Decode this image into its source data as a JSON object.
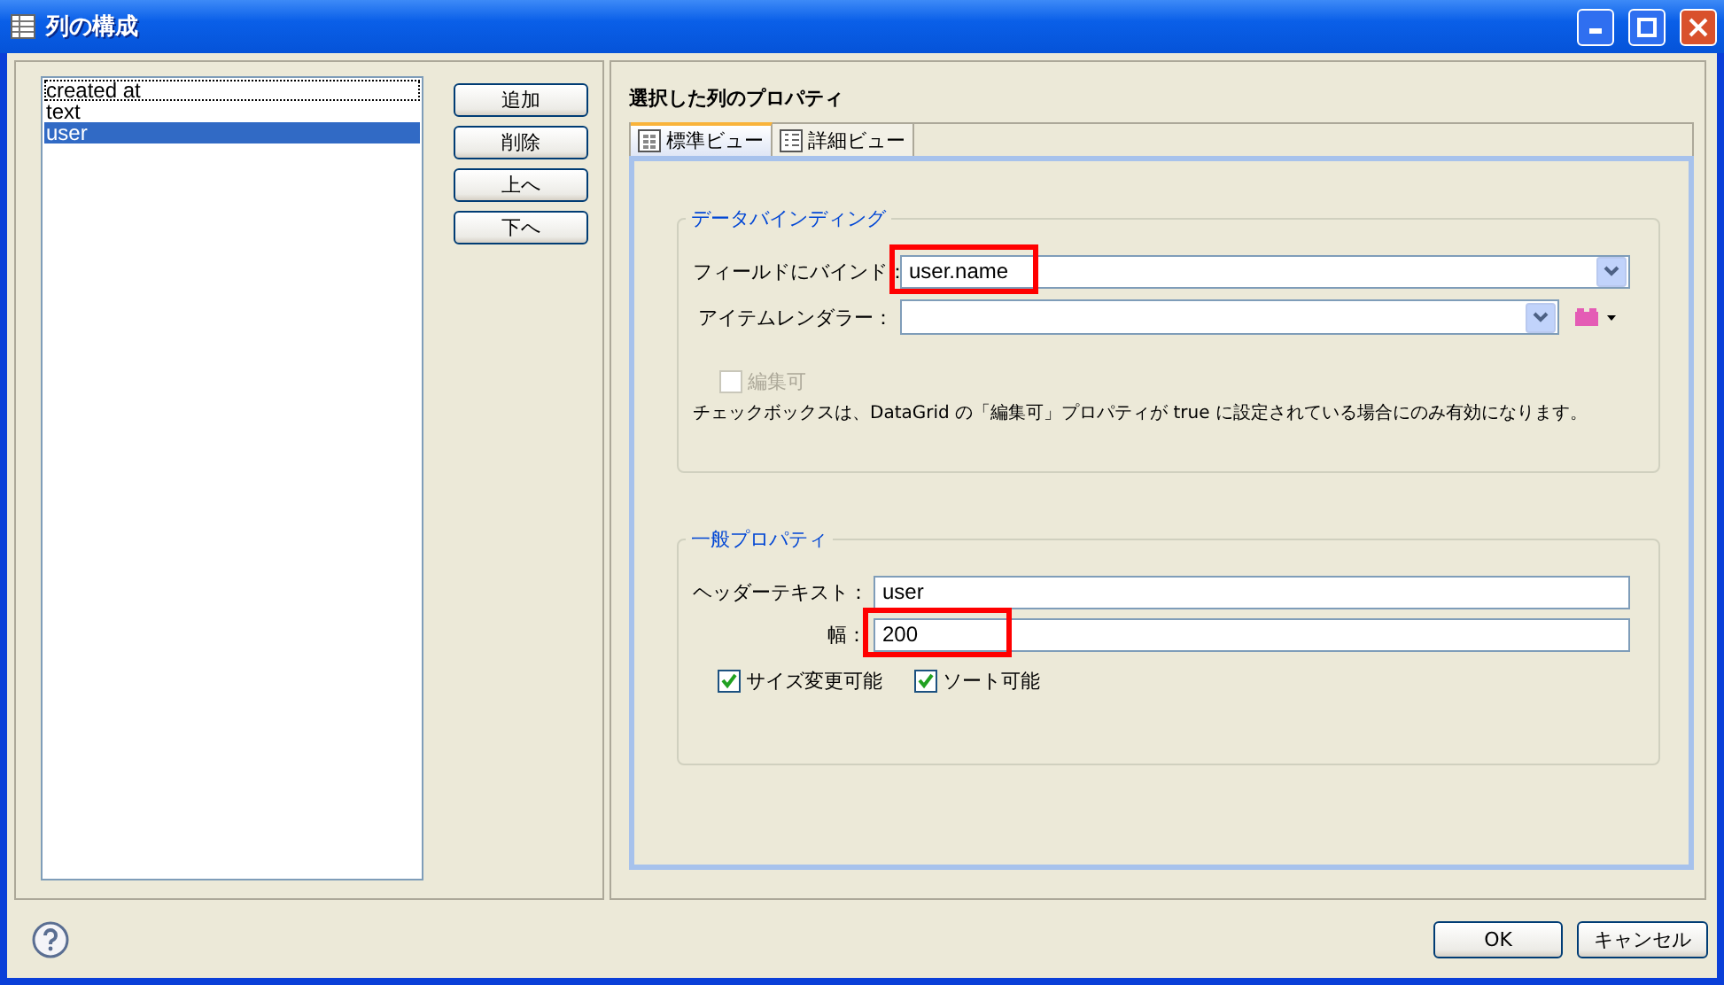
{
  "window": {
    "title": "列の構成"
  },
  "columns_list": [
    {
      "label": "created at",
      "selected": false,
      "focused": true
    },
    {
      "label": "text",
      "selected": false,
      "focused": false
    },
    {
      "label": "user",
      "selected": true,
      "focused": false
    }
  ],
  "list_buttons": [
    "追加",
    "削除",
    "上へ",
    "下へ"
  ],
  "properties": {
    "heading": "選択した列のプロパティ",
    "tabs": [
      {
        "label": "標準ビュー",
        "selected": true
      },
      {
        "label": "詳細ビュー",
        "selected": false
      }
    ],
    "data_binding": {
      "title": "データバインディング",
      "bind_field": {
        "label": "フィールドにバインド：",
        "value": "user.name",
        "highlighted": true
      },
      "item_renderer": {
        "label": "アイテムレンダラー："
      },
      "editable": {
        "label": "編集可",
        "checked": false,
        "disabled": true
      },
      "note": "チェックボックスは、DataGrid の「編集可」プロパティが true に設定されている場合にのみ有効になります。"
    },
    "general": {
      "title": "一般プロパティ",
      "header_text": {
        "label": "ヘッダーテキスト：",
        "value": "user"
      },
      "width": {
        "label": "幅：",
        "value": "200",
        "highlighted": true
      },
      "options": [
        {
          "label": "サイズ変更可能",
          "checked": true
        },
        {
          "label": "ソート可能",
          "checked": true
        }
      ]
    }
  },
  "footer_buttons": [
    "OK",
    "キャンセル"
  ]
}
